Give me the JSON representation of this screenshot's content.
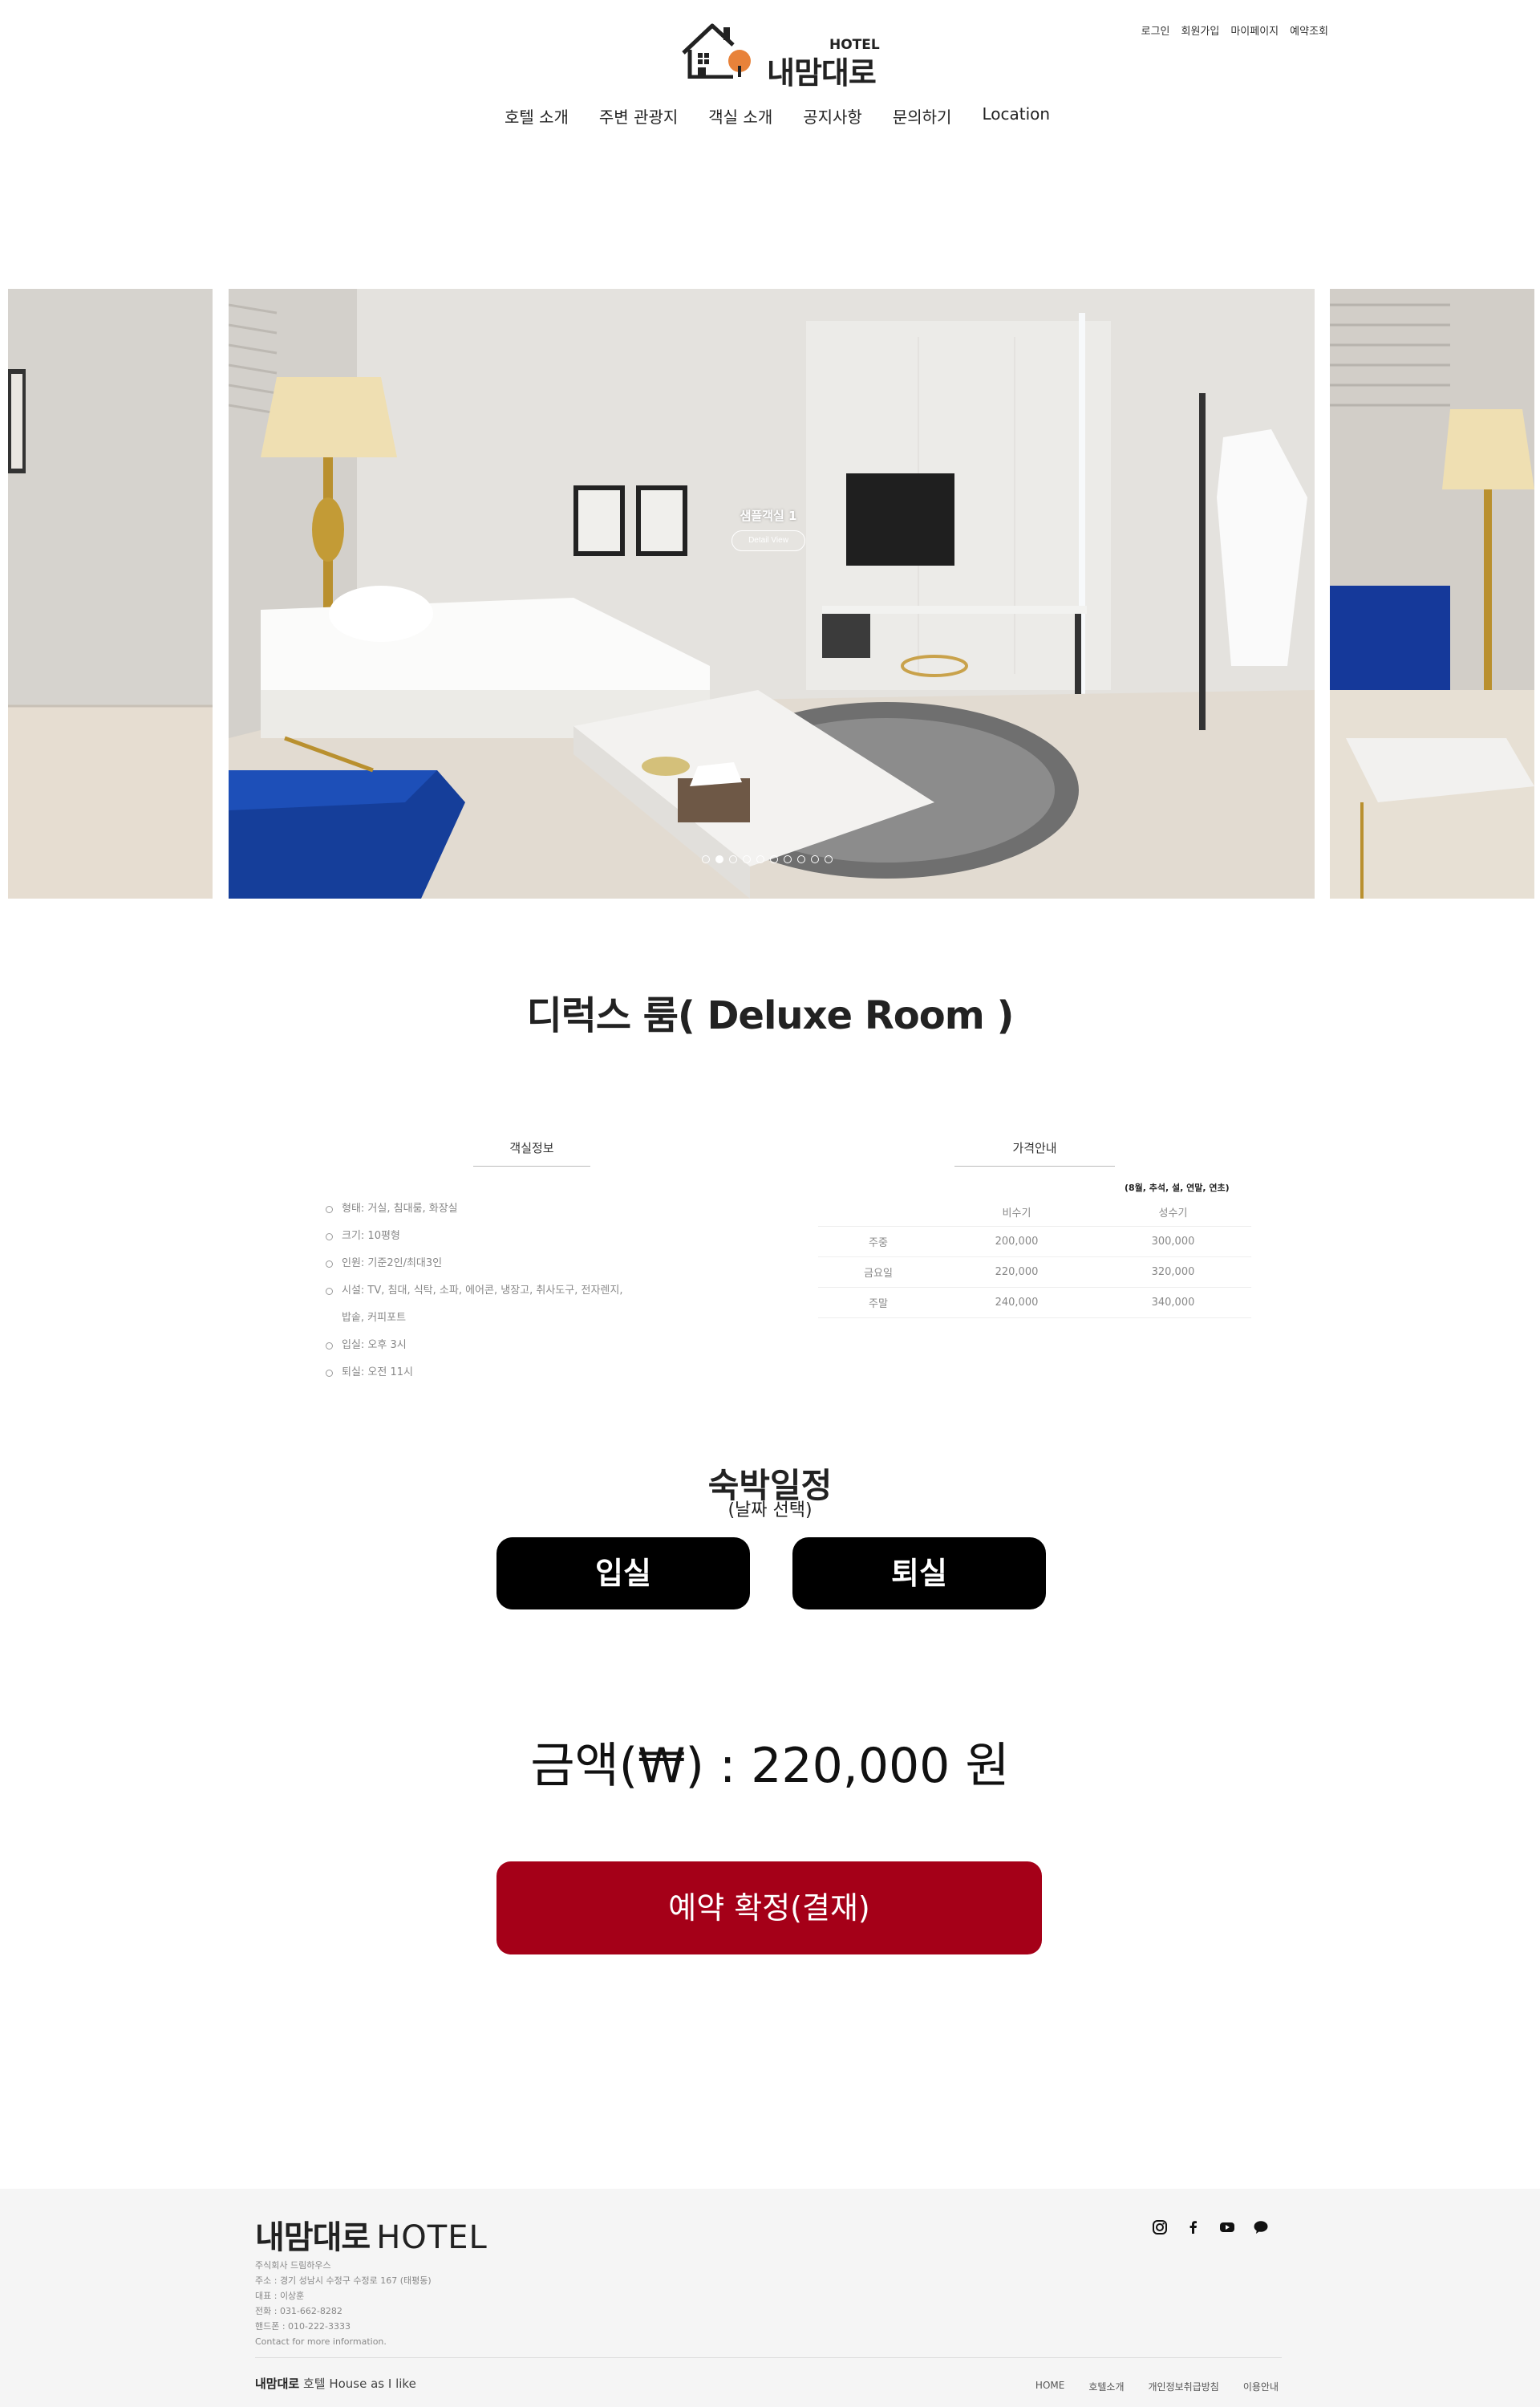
{
  "brand": {
    "name": "내맘대로",
    "hotel_tag": "HOTEL"
  },
  "util_menu": [
    "로그인",
    "회원가입",
    "마이페이지",
    "예약조회"
  ],
  "gnb": [
    "호텔 소개",
    "주변 관광지",
    "객실 소개",
    "공지사항",
    "문의하기",
    "Location"
  ],
  "slider": {
    "caption_title": "샘플객실 1",
    "caption_button": "Detail View",
    "dot_count": 10,
    "active_dot": 1
  },
  "room": {
    "title": "디럭스 룸( Deluxe Room )"
  },
  "room_info": {
    "heading": "객실정보",
    "items": [
      "형태: 거실, 침대룸, 화장실",
      "크기: 10평형",
      "인원: 기준2인/최대3인",
      "시설: TV, 침대, 식탁, 소파, 에어콘, 냉장고, 취사도구, 전자렌지, 밥솥, 커피포트",
      "입실: 오후 3시",
      "퇴실: 오전 11시"
    ]
  },
  "price_info": {
    "heading": "가격안내",
    "note": "(8월, 추석, 설, 연말, 연초)",
    "columns": [
      "",
      "비수기",
      "성수기"
    ],
    "rows": [
      [
        "주중",
        "200,000",
        "300,000"
      ],
      [
        "금요일",
        "220,000",
        "320,000"
      ],
      [
        "주말",
        "240,000",
        "340,000"
      ]
    ]
  },
  "booking": {
    "title": "숙박일정",
    "subtitle": "(날짜 선택)",
    "checkin_label": "입실",
    "checkout_label": "퇴실",
    "price_text": "금액(₩)  : 220,000 원",
    "confirm_label": "예약 확정(결재)"
  },
  "footer": {
    "logo_kr": "내맘대로",
    "logo_en": "HOTEL",
    "info": [
      "주식회사 드림하우스",
      "주소 : 경기 성남시 수정구 수정로 167 (태평동)",
      "대표 : 이상훈",
      "전화 : 031-662-8282",
      "핸드폰 : 010-222-3333",
      "Contact for more information."
    ],
    "copy_brand": "내맘대로",
    "copy_rest": " 호텔 House as I like",
    "nav": [
      "HOME",
      "호텔소개",
      "개인정보취급방침",
      "이용안내"
    ],
    "sns": [
      "instagram-icon",
      "facebook-icon",
      "youtube-icon",
      "kakaotalk-icon"
    ]
  }
}
